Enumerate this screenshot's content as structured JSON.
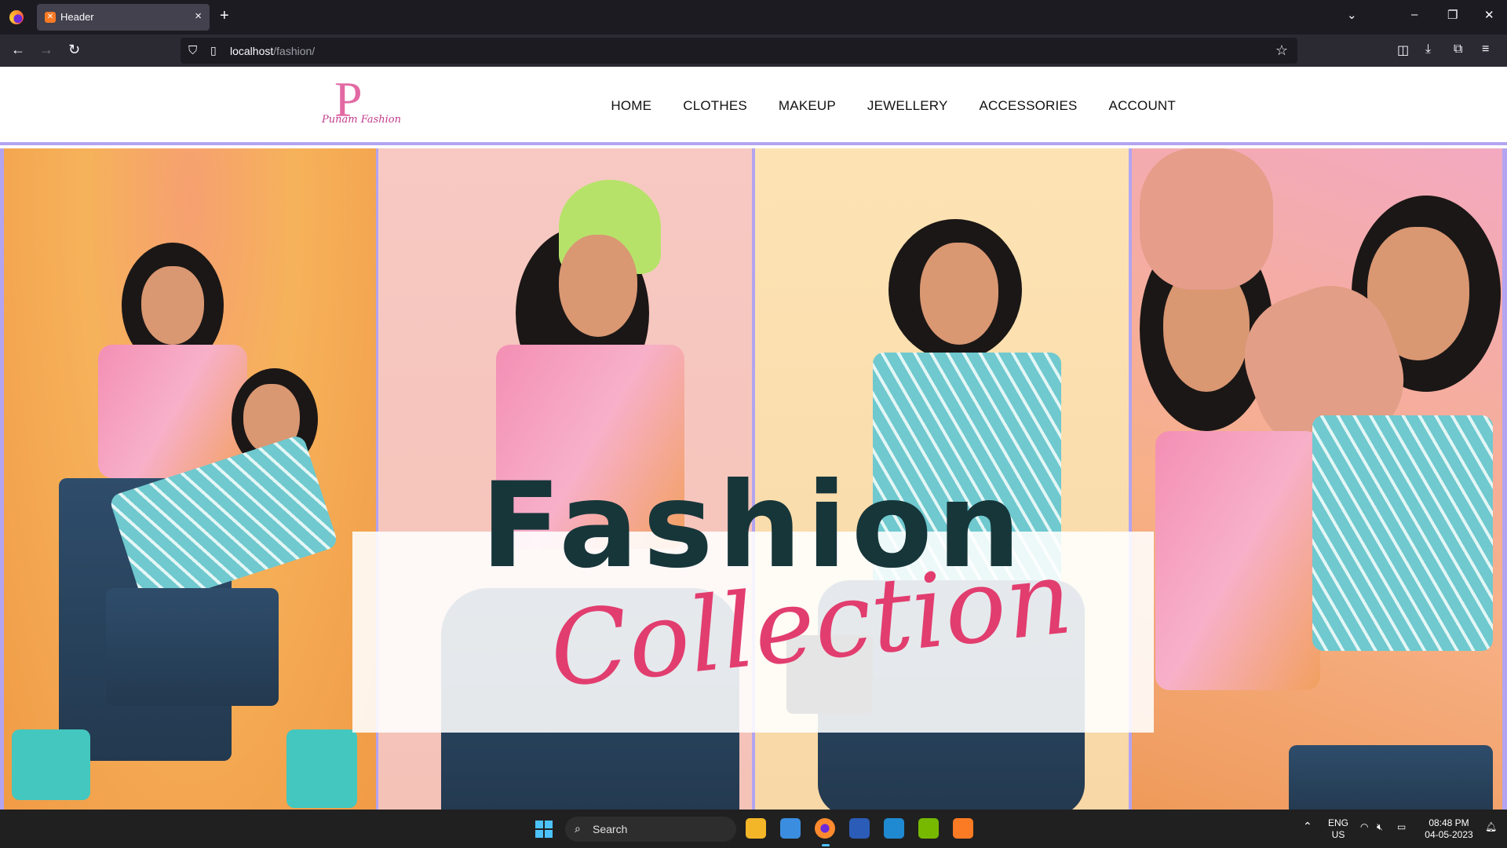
{
  "browser": {
    "tab_title": "Header",
    "url_host": "localhost",
    "url_path": "/fashion/"
  },
  "site": {
    "logo_letter": "P",
    "logo_script": "Punam Fashion",
    "menu": [
      "HOME",
      "CLOTHES",
      "MAKEUP",
      "JEWELLERY",
      "ACCESSORIES",
      "ACCOUNT"
    ],
    "hero_title": "Fashion",
    "hero_subtitle": "Collection",
    "colors": {
      "title": "#17363a",
      "script": "#e23d6f",
      "border": "#b3a4f0"
    }
  },
  "taskbar": {
    "search_label": "Search",
    "lang_top": "ENG",
    "lang_bottom": "US",
    "time": "08:48 PM",
    "date": "04-05-2023"
  }
}
